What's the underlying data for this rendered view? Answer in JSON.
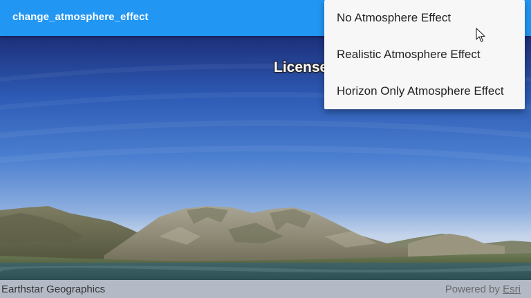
{
  "appbar": {
    "title": "change_atmosphere_effect"
  },
  "map": {
    "license_text": "License",
    "attribution": "Earthstar Geographics",
    "powered_by_prefix": "Powered by ",
    "powered_by_link": "Esri"
  },
  "menu": {
    "items": [
      {
        "label": "No Atmosphere Effect"
      },
      {
        "label": "Realistic Atmosphere Effect"
      },
      {
        "label": "Horizon Only Atmosphere Effect"
      }
    ]
  },
  "colors": {
    "appbar": "#2196f3",
    "menu_background": "#f7f7f7",
    "sky_top": "#1d2f7a",
    "sky_horizon": "#b9cde8"
  },
  "icons": {
    "cursor": "mouse-pointer-icon"
  }
}
